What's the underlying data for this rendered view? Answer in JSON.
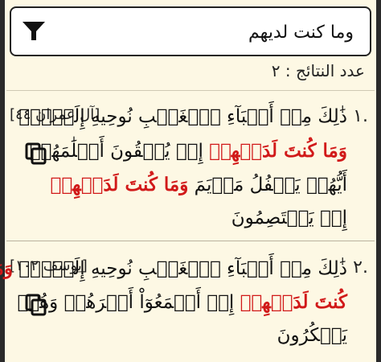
{
  "search": {
    "query": "وما كنت لديهم",
    "filter_icon": "filter-funnel-icon"
  },
  "results_label": "عدد النتائج : ٢",
  "results": [
    {
      "number": ".١",
      "reference": "[آل عمران ٤٤]",
      "lines": [
        [
          {
            "t": "ذَٰلِكَ مِنۡ أَنۢبَآءِ ٱلۡغَيۡبِ نُوحِيهِ إِلَيۡكَۚ",
            "h": false
          }
        ],
        [
          {
            "t": "وَمَا كُنتَ لَدَيۡهِمۡ",
            "h": true
          },
          {
            "t": " إِذۡ يُلۡقُونَ أَقۡلَٰمَهُمۡ",
            "h": false
          }
        ],
        [
          {
            "t": "أَيُّهُمۡ يَكۡفُلُ مَرۡيَمَ ",
            "h": false
          },
          {
            "t": "وَمَا كُنتَ لَدَيۡهِمۡ",
            "h": true
          }
        ],
        [
          {
            "t": "إِذۡ يَخۡتَصِمُونَ",
            "h": false
          }
        ]
      ]
    },
    {
      "number": ".٢",
      "reference": "[يوسف ١٠٢]",
      "lines": [
        [
          {
            "t": "ذَٰلِكَ مِنۡ أَنۢبَآءِ ٱلۡغَيۡبِ نُوحِيهِ إِلَيۡكَۖ ",
            "h": false
          },
          {
            "t": "وَمَا",
            "h": true
          }
        ],
        [
          {
            "t": "كُنتَ لَدَيۡهِمۡ",
            "h": true
          },
          {
            "t": " إِذۡ أَجۡمَعُوٓاْ أَمۡرَهُمۡ وَهُمۡ",
            "h": false
          }
        ],
        [
          {
            "t": "يَمۡكُرُونَ",
            "h": false
          }
        ]
      ]
    }
  ],
  "colors": {
    "background": "#fdf8e4",
    "highlight": "#d11919"
  }
}
